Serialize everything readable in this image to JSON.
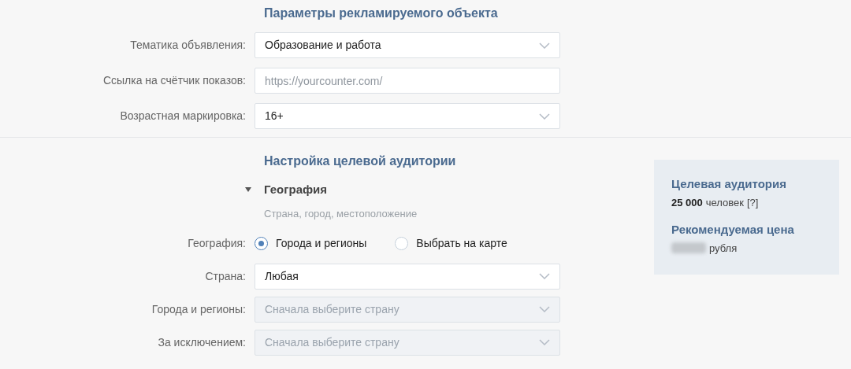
{
  "ad_object": {
    "title": "Параметры рекламируемого объекта",
    "fields": [
      {
        "kind": "select",
        "label": "Тематика объявления:",
        "value": "Образование и работа",
        "disabled": false
      },
      {
        "kind": "input",
        "label": "Ссылка на счётчик показов:",
        "placeholder": "https://yourcounter.com/"
      },
      {
        "kind": "select",
        "label": "Возрастная маркировка:",
        "value": "16+",
        "disabled": false
      }
    ]
  },
  "audience": {
    "title": "Настройка целевой аудитории",
    "group": {
      "title": "География",
      "subtitle": "Страна, город, местоположение",
      "expanded": true,
      "fields": [
        {
          "kind": "radio",
          "label": "География:",
          "options": [
            {
              "label": "Города и регионы",
              "selected": true
            },
            {
              "label": "Выбрать на карте",
              "selected": false
            }
          ]
        },
        {
          "kind": "select",
          "label": "Страна:",
          "value": "Любая",
          "disabled": false
        },
        {
          "kind": "select",
          "label": "Города и регионы:",
          "placeholder": "Сначала выберите страну",
          "disabled": true
        },
        {
          "kind": "select",
          "label": "За исключением:",
          "placeholder": "Сначала выберите страну",
          "disabled": true
        }
      ]
    }
  },
  "summary": {
    "audience_title": "Целевая аудитория",
    "audience_count": "25 000",
    "audience_unit": "человек",
    "help": "[?]",
    "price_title": "Рекомендуемая цена",
    "price_unit": "рубля"
  }
}
